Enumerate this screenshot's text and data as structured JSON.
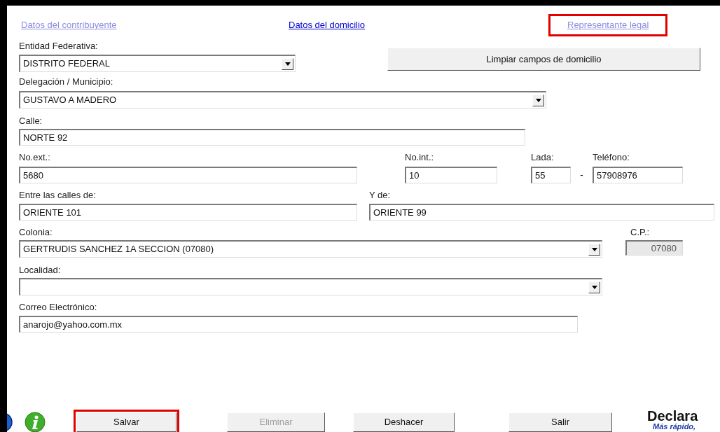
{
  "tabs": [
    {
      "label": "Datos del contribuyente",
      "selected": false,
      "highlighted": false
    },
    {
      "label": "Datos del domicilio",
      "selected": true,
      "highlighted": false
    },
    {
      "label": "Representante legal",
      "selected": false,
      "highlighted": true
    }
  ],
  "entidad": {
    "label": "Entidad Federativa:",
    "value": "DISTRITO FEDERAL"
  },
  "clear_button": "Limpiar campos de domicilio",
  "municipio": {
    "label": "Delegación / Municipio:",
    "value": "GUSTAVO A MADERO"
  },
  "calle": {
    "label": "Calle:",
    "value": "NORTE 92"
  },
  "no_ext": {
    "label": "No.ext.:",
    "value": "5680"
  },
  "no_int": {
    "label": "No.int.:",
    "value": "10"
  },
  "lada": {
    "label": "Lada:",
    "value": "55"
  },
  "separator": "-",
  "telefono": {
    "label": "Teléfono:",
    "value": "57908976"
  },
  "entre_calles": {
    "label": "Entre las calles de:",
    "value": "ORIENTE 101"
  },
  "y_de": {
    "label": "Y de:",
    "value": "ORIENTE 99"
  },
  "colonia": {
    "label": "Colonia:",
    "value": "GERTRUDIS SANCHEZ 1A SECCION (07080)"
  },
  "cp": {
    "label": "C.P.:",
    "value": "07080",
    "disabled": true
  },
  "localidad": {
    "label": "Localidad:"
  },
  "correo": {
    "label": "Correo Electrónico:",
    "value": "anarojo@yahoo.com.mx"
  },
  "buttons": [
    {
      "label": "Salvar",
      "disabled": false,
      "highlighted": true
    },
    {
      "label": "Eliminar",
      "disabled": true,
      "highlighted": false
    },
    {
      "label": "Deshacer",
      "disabled": false,
      "highlighted": false
    },
    {
      "label": "Salir",
      "disabled": false,
      "highlighted": false
    }
  ],
  "logo": {
    "title": "Declara",
    "tagline": "Más rápido,"
  }
}
